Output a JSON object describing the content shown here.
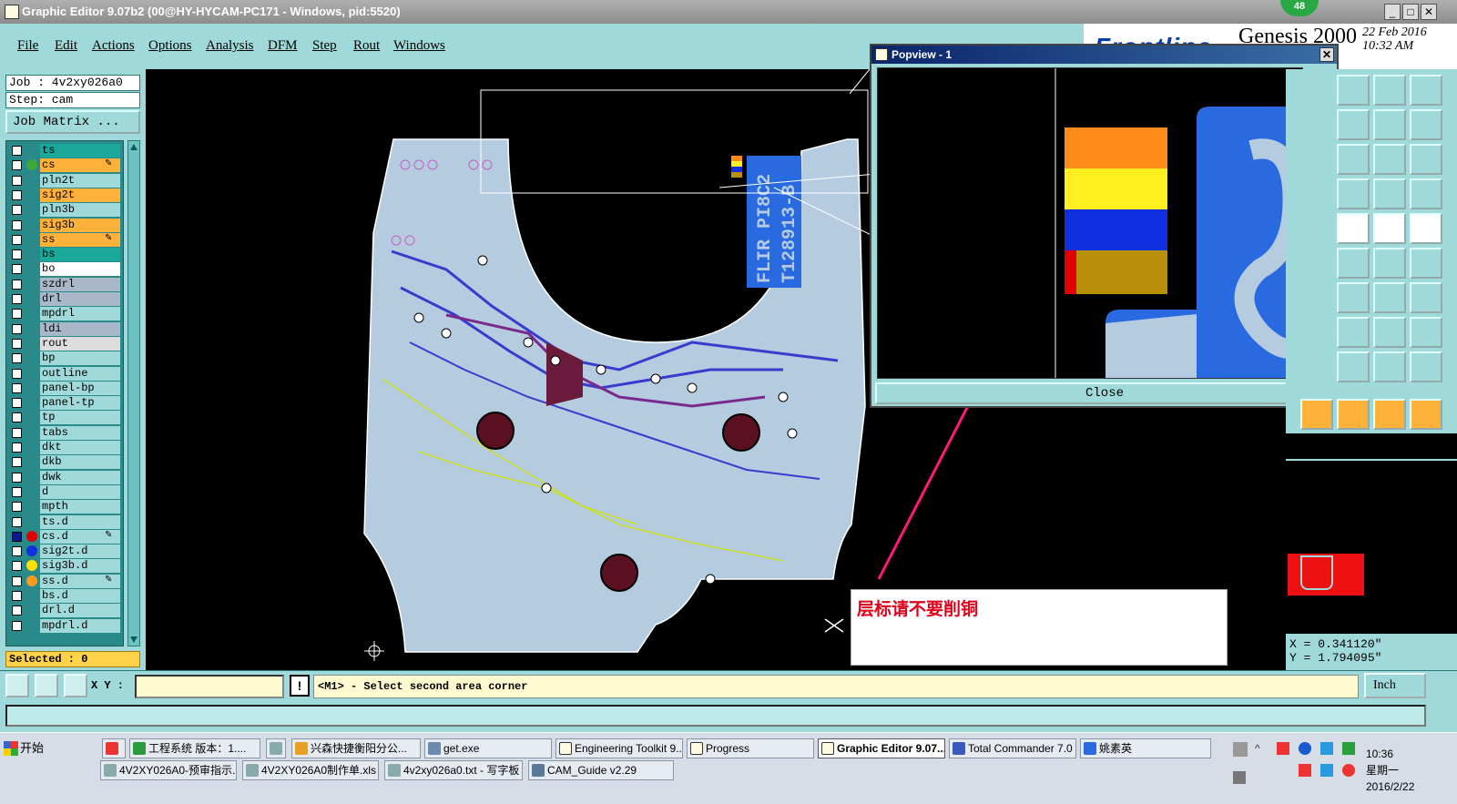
{
  "window": {
    "title": "Graphic Editor 9.07b2 (00@HY-HYCAM-PC171 - Windows, pid:5520)",
    "notification_count": "48"
  },
  "menu": [
    "File",
    "Edit",
    "Actions",
    "Options",
    "Analysis",
    "DFM",
    "Step",
    "Rout",
    "Windows"
  ],
  "logo": {
    "brand": "Frontline",
    "product": "Genesis 2000",
    "date": "22 Feb 2016",
    "time": "10:32 AM"
  },
  "job": {
    "job_label": "Job : 4v2xy026a0",
    "step_label": "Step: cam",
    "matrix_button": "Job Matrix ..."
  },
  "layers": [
    {
      "name": "ts",
      "bg": "#1aa89a",
      "dot": ""
    },
    {
      "name": "cs",
      "bg": "#ffb13a",
      "dot": "#3aa83a",
      "edit": true
    },
    {
      "name": "pln2t",
      "bg": "#9fd9d9",
      "dot": ""
    },
    {
      "name": "sig2t",
      "bg": "#ffb13a",
      "dot": ""
    },
    {
      "name": "pln3b",
      "bg": "#9fd9d9",
      "dot": ""
    },
    {
      "name": "sig3b",
      "bg": "#ffb13a",
      "dot": ""
    },
    {
      "name": "ss",
      "bg": "#ffb13a",
      "dot": "",
      "edit": true
    },
    {
      "name": "bs",
      "bg": "#1aa89a",
      "dot": ""
    },
    {
      "name": "bo",
      "bg": "#ffffff",
      "dot": ""
    },
    {
      "name": "szdrl",
      "bg": "#a8b8c8",
      "dot": ""
    },
    {
      "name": "drl",
      "bg": "#a8b8c8",
      "dot": ""
    },
    {
      "name": "mpdrl",
      "bg": "#9fd9d9",
      "dot": ""
    },
    {
      "name": "ldi",
      "bg": "#a8b8c8",
      "dot": ""
    },
    {
      "name": "rout",
      "bg": "#dddddd",
      "dot": ""
    },
    {
      "name": "bp",
      "bg": "#9fd9d9",
      "dot": ""
    },
    {
      "name": "outline",
      "bg": "#9fd9d9",
      "dot": ""
    },
    {
      "name": "panel-bp",
      "bg": "#9fd9d9",
      "dot": ""
    },
    {
      "name": "panel-tp",
      "bg": "#9fd9d9",
      "dot": ""
    },
    {
      "name": "tp",
      "bg": "#9fd9d9",
      "dot": ""
    },
    {
      "name": "tabs",
      "bg": "#9fd9d9",
      "dot": ""
    },
    {
      "name": "dkt",
      "bg": "#9fd9d9",
      "dot": ""
    },
    {
      "name": "dkb",
      "bg": "#9fd9d9",
      "dot": ""
    },
    {
      "name": "dwk",
      "bg": "#9fd9d9",
      "dot": ""
    },
    {
      "name": "d",
      "bg": "#9fd9d9",
      "dot": ""
    },
    {
      "name": "mpth",
      "bg": "#9fd9d9",
      "dot": ""
    },
    {
      "name": "ts.d",
      "bg": "#9fd9d9",
      "dot": ""
    },
    {
      "name": "cs.d",
      "bg": "#9fd9d9",
      "dot": "#e00000",
      "edit": true
    },
    {
      "name": "sig2t.d",
      "bg": "#9fd9d9",
      "dot": "#1030e0"
    },
    {
      "name": "sig3b.d",
      "bg": "#9fd9d9",
      "dot": "#ffe000"
    },
    {
      "name": "ss.d",
      "bg": "#9fd9d9",
      "dot": "#ff9a20",
      "edit": true
    },
    {
      "name": "bs.d",
      "bg": "#9fd9d9",
      "dot": ""
    },
    {
      "name": "drl.d",
      "bg": "#9fd9d9",
      "dot": ""
    },
    {
      "name": "mpdrl.d",
      "bg": "#9fd9d9",
      "dot": ""
    }
  ],
  "selected": "Selected : 0",
  "board": {
    "silk_line1": "FLIR PI8C2",
    "silk_line2": "T128913-B"
  },
  "popview": {
    "title": "Popview - 1",
    "close_label": "Close"
  },
  "annotation": "层标请不要削铜",
  "coords": {
    "x": "X = 0.341120\"",
    "y": "Y = 1.794095\""
  },
  "status": {
    "xy_label": "X Y :",
    "xy_value": "",
    "message": "<M1> - Select second area corner",
    "unit": "Inch"
  },
  "taskbar": {
    "start": "开始",
    "row1": [
      "工程系统  版本：1....",
      "兴森快捷衡阳分公...",
      "get.exe",
      "Engineering Toolkit 9....",
      "Progress",
      "Graphic Editor 9.07...",
      "Total Commander 7.0 ...",
      "姚素英"
    ],
    "row2": [
      "4V2XY026A0-预审指示....",
      "4V2XY026A0制作单.xls ...",
      "4v2xy026a0.txt - 写字板",
      "CAM_Guide v2.29"
    ],
    "clock_time": "10:36",
    "clock_day": "星期一",
    "clock_date": "2016/2/22"
  },
  "colors": {
    "panel": "#9fd9d9",
    "board_fill": "#b5cce0",
    "trace": "#3a3acc",
    "silk": "#c8e020",
    "annotation_text": "#e0001a",
    "arrow": "#ff1a7a"
  }
}
